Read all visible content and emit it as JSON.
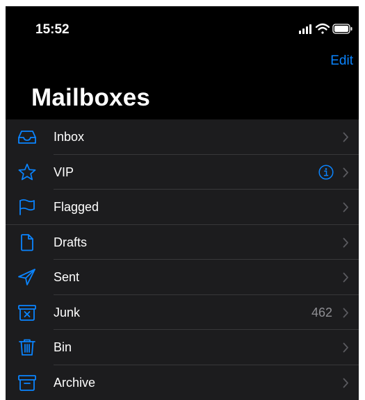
{
  "status_bar": {
    "time": "15:52",
    "icons": [
      "signal-icon",
      "wifi-icon",
      "battery-icon"
    ]
  },
  "nav": {
    "edit_label": "Edit"
  },
  "title": "Mailboxes",
  "colors": {
    "accent": "#0a84ff",
    "background": "#000000",
    "list_background": "#1c1c1e",
    "separator": "#38383a",
    "secondary_text": "#8e8e93"
  },
  "mailboxes": [
    {
      "label": "Inbox",
      "icon": "inbox-tray-icon"
    },
    {
      "label": "VIP",
      "icon": "star-icon",
      "accessory": "info-icon"
    },
    {
      "label": "Flagged",
      "icon": "flag-icon"
    },
    {
      "label": "Drafts",
      "icon": "document-icon"
    },
    {
      "label": "Sent",
      "icon": "paper-plane-icon"
    },
    {
      "label": "Junk",
      "icon": "junk-bin-icon",
      "count": "462"
    },
    {
      "label": "Bin",
      "icon": "trash-icon"
    },
    {
      "label": "Archive",
      "icon": "archive-box-icon"
    }
  ]
}
